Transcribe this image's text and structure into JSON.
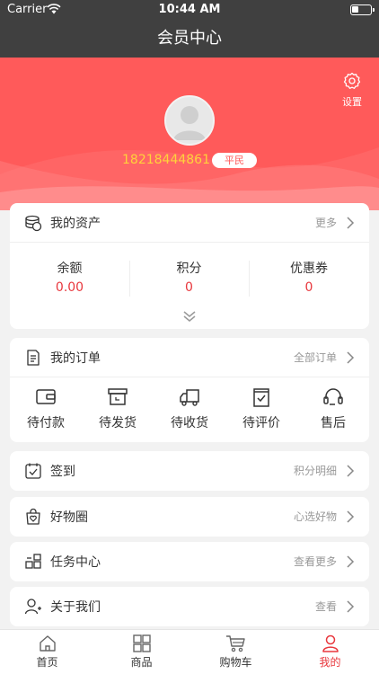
{
  "status_bar": {
    "carrier": "Carrier",
    "time": "10:44 AM"
  },
  "nav": {
    "title": "会员中心"
  },
  "profile": {
    "settings_label": "设置",
    "phone": "18218444861",
    "level": "平民"
  },
  "assets": {
    "title": "我的资产",
    "more": "更多",
    "items": [
      {
        "name": "余额",
        "value": "0.00"
      },
      {
        "name": "积分",
        "value": "0"
      },
      {
        "name": "优惠券",
        "value": "0"
      }
    ]
  },
  "orders": {
    "title": "我的订单",
    "more": "全部订单",
    "items": [
      {
        "label": "待付款",
        "icon": "wallet-icon"
      },
      {
        "label": "待发货",
        "icon": "box-icon"
      },
      {
        "label": "待收货",
        "icon": "truck-icon"
      },
      {
        "label": "待评价",
        "icon": "clipboard-check-icon"
      },
      {
        "label": "售后",
        "icon": "headset-icon"
      }
    ]
  },
  "list": [
    {
      "title": "签到",
      "more": "积分明细",
      "icon": "checkin-icon"
    },
    {
      "title": "好物圈",
      "more": "心选好物",
      "icon": "bag-heart-icon"
    },
    {
      "title": "任务中心",
      "more": "查看更多",
      "icon": "task-icon"
    },
    {
      "title": "关于我们",
      "more": "查看",
      "icon": "user-add-icon"
    }
  ],
  "tabs": [
    {
      "label": "首页",
      "icon": "home-icon"
    },
    {
      "label": "商品",
      "icon": "grid-icon"
    },
    {
      "label": "购物车",
      "icon": "cart-icon"
    },
    {
      "label": "我的",
      "icon": "person-icon",
      "active": true
    }
  ],
  "colors": {
    "primary": "#ff5a5a",
    "accent_text": "#e8373d",
    "phone": "#ffd23a",
    "header_bg": "#404040"
  }
}
